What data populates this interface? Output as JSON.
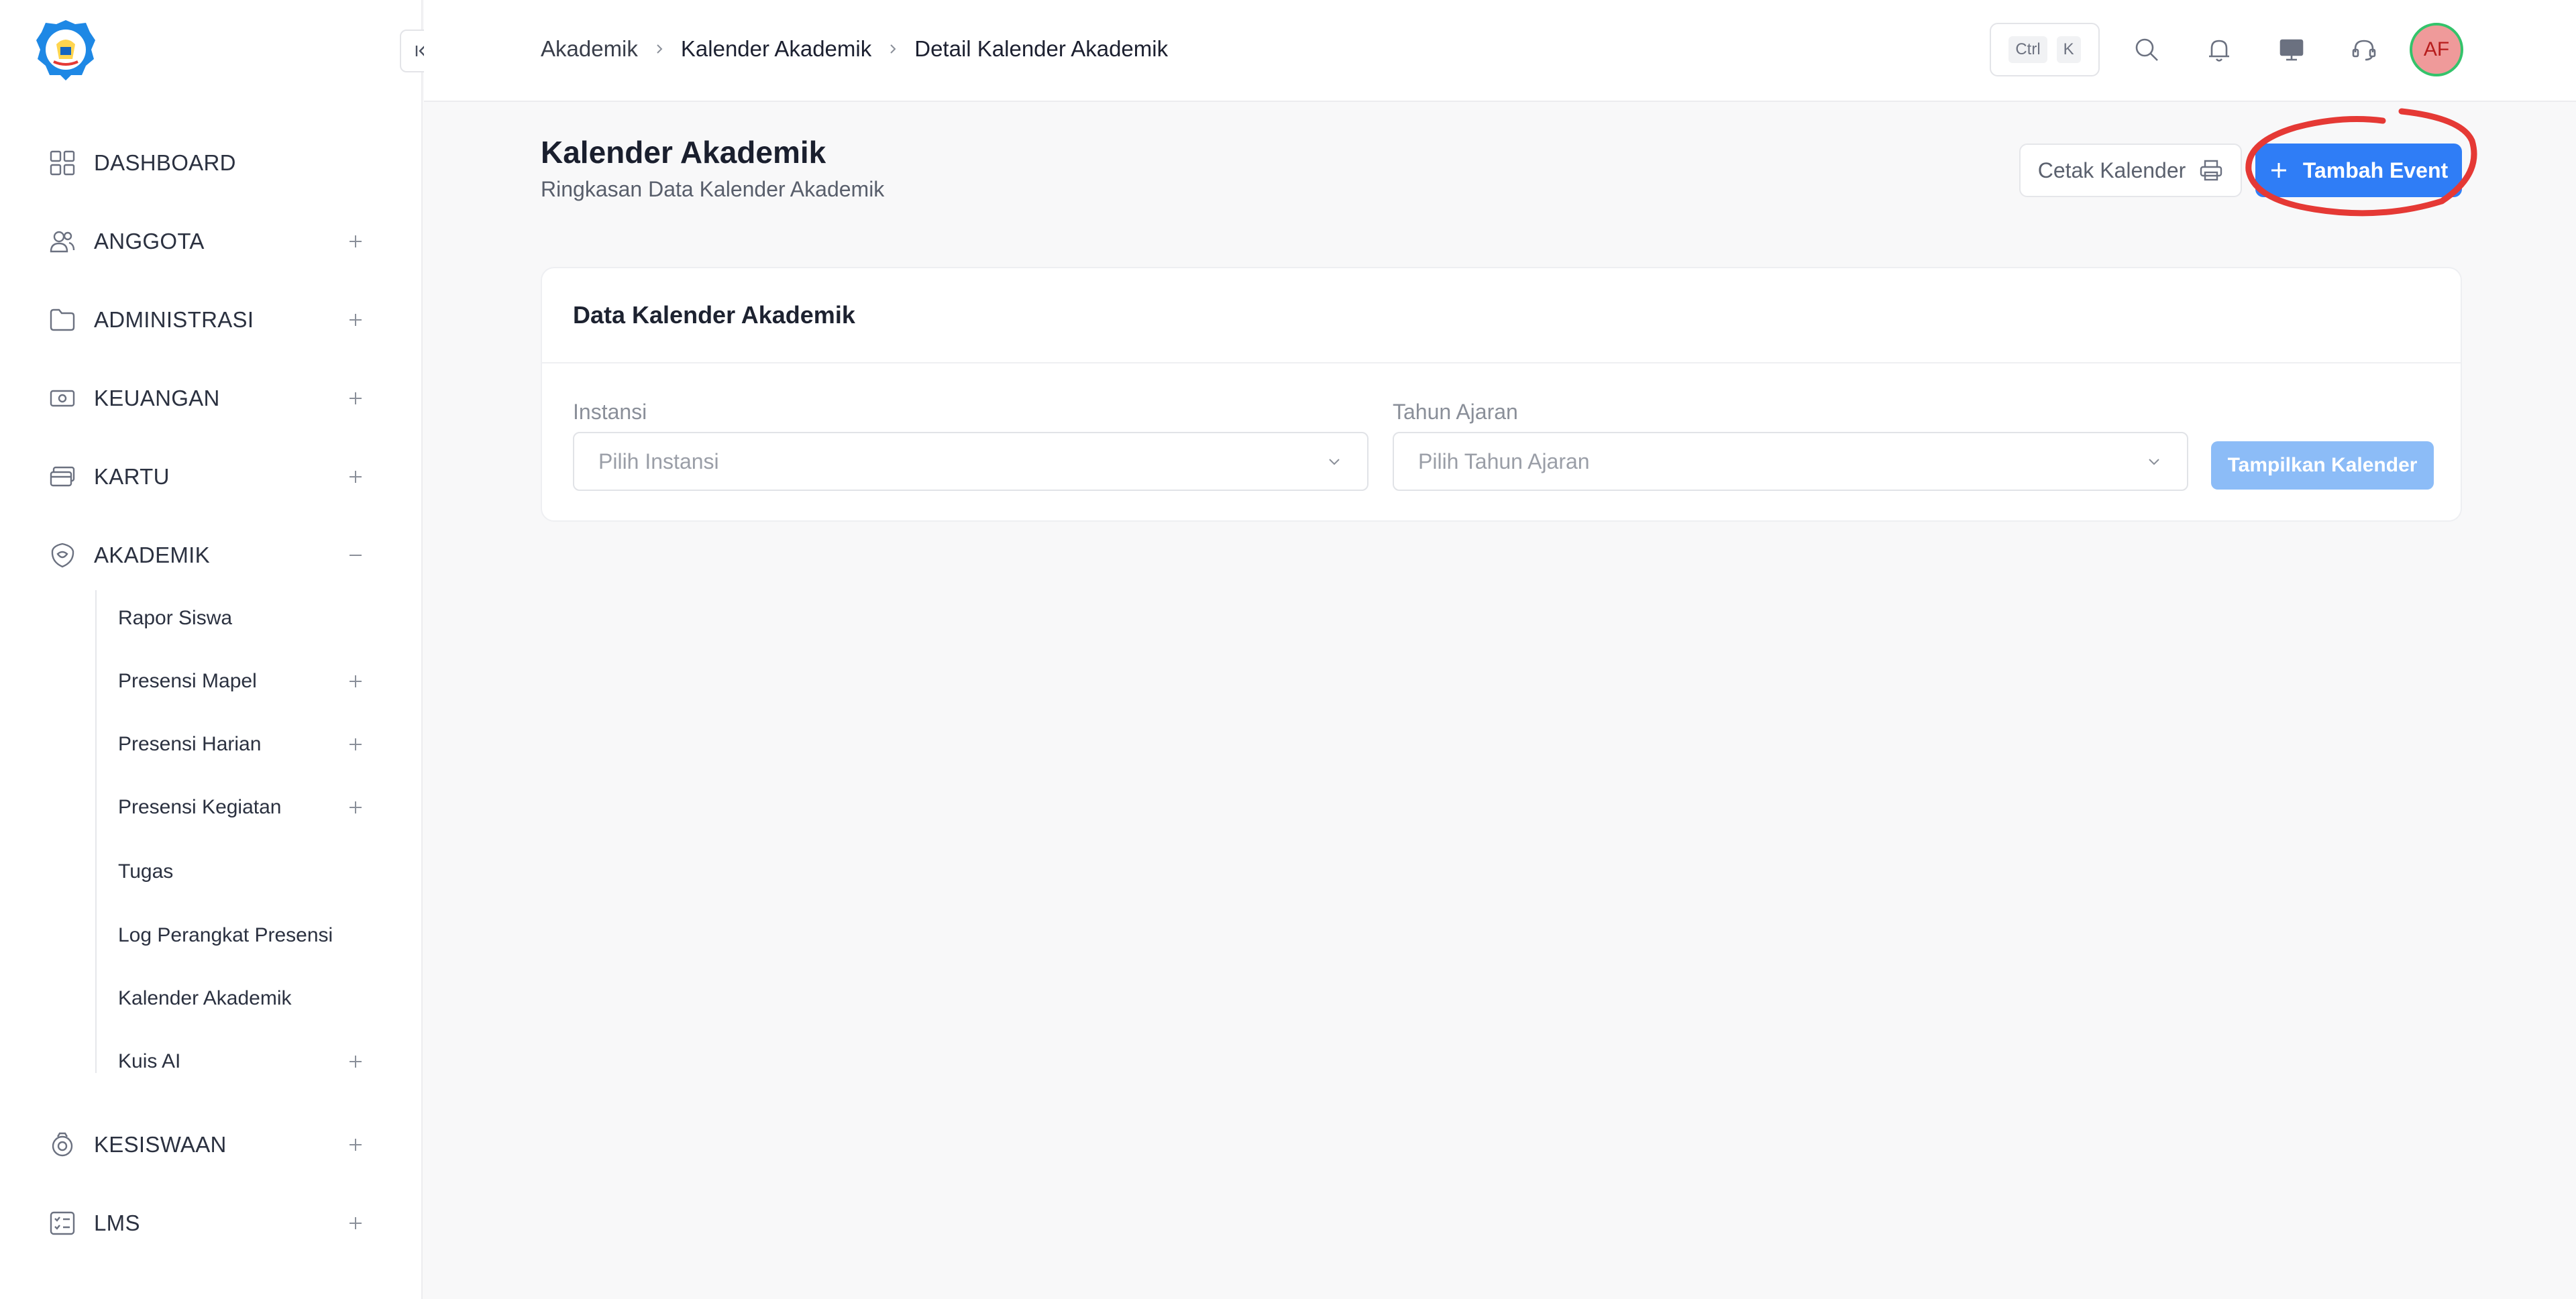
{
  "sidebar": {
    "nav": [
      {
        "label": "DASHBOARD",
        "icon": "dashboard-grid-icon"
      },
      {
        "label": "ANGGOTA",
        "icon": "users-icon"
      },
      {
        "label": "ADMINISTRASI",
        "icon": "folder-icon"
      },
      {
        "label": "KEUANGAN",
        "icon": "money-icon"
      },
      {
        "label": "KARTU",
        "icon": "card-icon"
      },
      {
        "label": "AKADEMIK",
        "icon": "academic-icon"
      },
      {
        "label": "KESISWAAN",
        "icon": "student-icon"
      },
      {
        "label": "LMS",
        "icon": "checklist-icon"
      }
    ],
    "akademik_sub": [
      {
        "label": "Rapor Siswa"
      },
      {
        "label": "Presensi Mapel"
      },
      {
        "label": "Presensi Harian"
      },
      {
        "label": "Presensi Kegiatan"
      },
      {
        "label": "Tugas"
      },
      {
        "label": "Log Perangkat Presensi"
      },
      {
        "label": "Kalender Akademik"
      },
      {
        "label": "Kuis AI"
      }
    ]
  },
  "header": {
    "breadcrumb": [
      "Akademik",
      "Kalender Akademik",
      "Detail Kalender Akademik"
    ],
    "shortcut": [
      "Ctrl",
      "K"
    ],
    "avatar_initials": "AF"
  },
  "main": {
    "title": "Kalender Akademik",
    "subtitle": "Ringkasan Data Kalender Akademik",
    "print_label": "Cetak Kalender",
    "add_label": "Tambah Event",
    "card": {
      "title": "Data Kalender Akademik",
      "instansi_label": "Instansi",
      "instansi_placeholder": "Pilih Instansi",
      "tahun_label": "Tahun Ajaran",
      "tahun_placeholder": "Pilih Tahun Ajaran",
      "show_label": "Tampilkan Kalender"
    }
  },
  "colors": {
    "primary": "#2f7df6",
    "primary_disabled": "#8cbcf7",
    "annotation": "#e53935",
    "avatar_bg": "#ef9a9a"
  }
}
